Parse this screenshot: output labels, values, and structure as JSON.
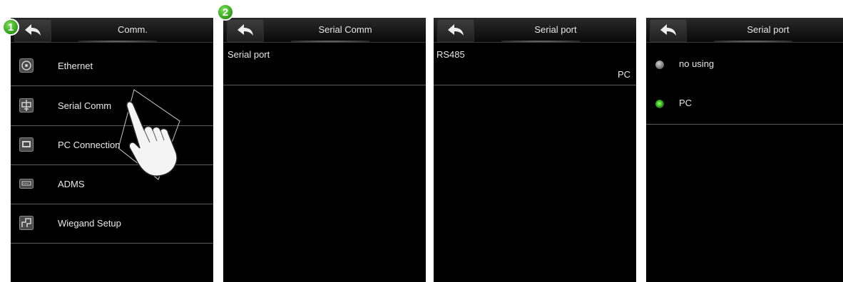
{
  "steps": [
    "1",
    "2"
  ],
  "screen1": {
    "title": "Comm.",
    "items": [
      {
        "label": "Ethernet",
        "icon": "ethernet-icon"
      },
      {
        "label": "Serial Comm",
        "icon": "serial-comm-icon"
      },
      {
        "label": "PC Connection",
        "icon": "pc-connection-icon"
      },
      {
        "label": "ADMS",
        "icon": "adms-icon"
      },
      {
        "label": "Wiegand Setup",
        "icon": "wiegand-setup-icon"
      }
    ]
  },
  "screen2": {
    "title": "Serial Comm",
    "row_label": "Serial port"
  },
  "screen3": {
    "title": "Serial port",
    "row_label": "RS485",
    "row_value": "PC"
  },
  "screen4": {
    "title": "Serial port",
    "options": [
      {
        "label": "no using",
        "selected": false
      },
      {
        "label": "PC",
        "selected": true
      }
    ]
  },
  "colors": {
    "background": "#000000",
    "selected_radio": "#2fb814",
    "badge": "#2f9a18"
  }
}
